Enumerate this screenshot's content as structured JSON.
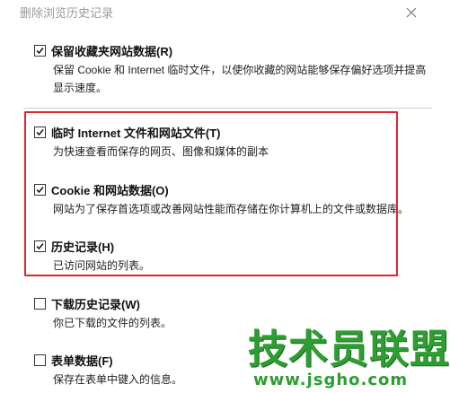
{
  "window": {
    "title": "删除浏览历史记录"
  },
  "options": [
    {
      "label": "保留收藏夹网站数据(R)",
      "checked": true,
      "description": "保留 Cookie 和 Internet 临时文件，以使你收藏的网站能够保存偏好选项并提高显示速度。"
    },
    {
      "label": "临时 Internet 文件和网站文件(T)",
      "checked": true,
      "description": "为快速查看而保存的网页、图像和媒体的副本"
    },
    {
      "label": "Cookie 和网站数据(O)",
      "checked": true,
      "description": "网站为了保存首选项或改善网站性能而存储在你计算机上的文件或数据库。"
    },
    {
      "label": "历史记录(H)",
      "checked": true,
      "description": "已访问网站的列表。"
    },
    {
      "label": "下载历史记录(W)",
      "checked": false,
      "description": "你已下载的文件的列表。"
    },
    {
      "label": "表单数据(F)",
      "checked": false,
      "description": "保存在表单中键入的信息。"
    }
  ],
  "watermark": {
    "text": "技术员联盟",
    "url": "www.jsgho.com"
  },
  "colors": {
    "highlight": "#e0252c",
    "watermark": "#2e9d32"
  },
  "icons": {
    "close": "close-icon",
    "check": "checkmark-icon"
  }
}
